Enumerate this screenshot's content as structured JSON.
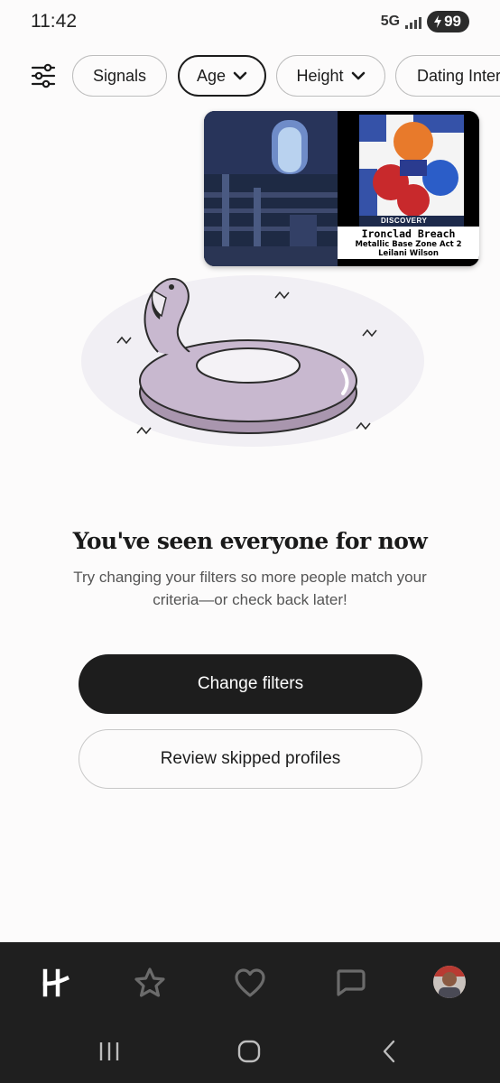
{
  "status_bar": {
    "time": "11:42",
    "network": "5G",
    "battery": "99"
  },
  "filters": {
    "chips": [
      {
        "label": "Signals"
      },
      {
        "label": "Age"
      },
      {
        "label": "Height"
      },
      {
        "label": "Dating Inter"
      }
    ]
  },
  "music_overlay": {
    "album_label": "DISCOVERY",
    "track_title": "Ironclad Breach",
    "track_subtitle": "Metallic Base Zone Act 2",
    "artist": "Leilani Wilson"
  },
  "empty_state": {
    "title": "You've seen everyone for now",
    "body": "Try changing your filters so more people match your criteria—or check back later!"
  },
  "actions": {
    "primary_label": "Change filters",
    "secondary_label": "Review skipped profiles"
  },
  "bottom_nav": {
    "items": [
      {
        "icon": "hinge-logo-icon"
      },
      {
        "icon": "star-icon"
      },
      {
        "icon": "heart-icon"
      },
      {
        "icon": "chat-icon"
      },
      {
        "icon": "profile-avatar"
      }
    ]
  },
  "system_nav": {
    "items": [
      "recents-icon",
      "home-icon",
      "back-icon"
    ]
  },
  "colors": {
    "background": "#fcfbfb",
    "primary_button": "#1d1d1d",
    "nav_background": "#1f1f1f",
    "flamingo": "#c8b8cf"
  }
}
